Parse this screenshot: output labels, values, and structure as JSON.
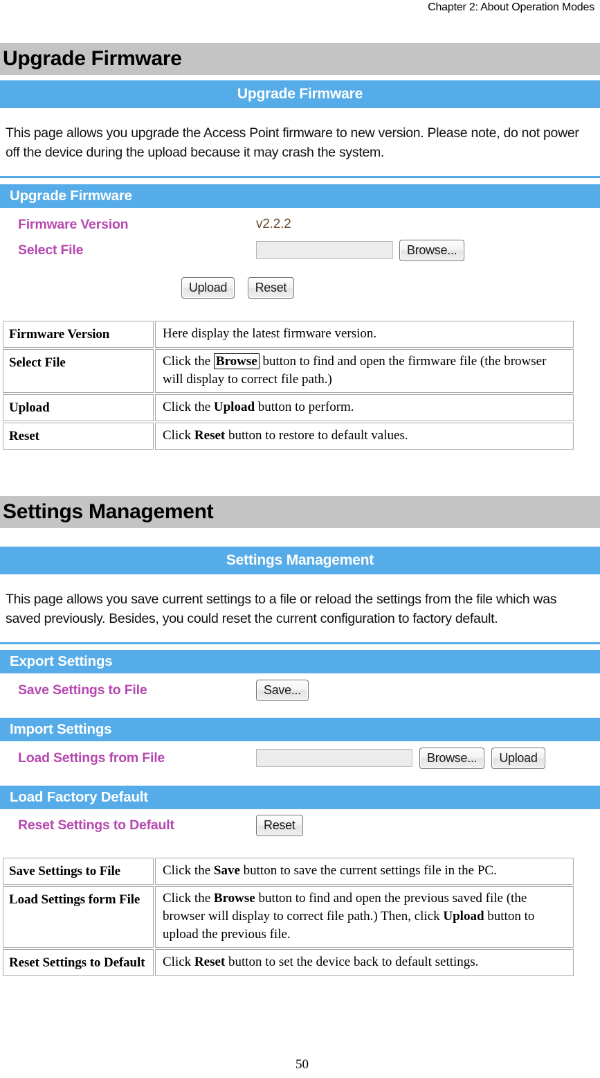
{
  "page": {
    "running_header": "Chapter 2: About Operation Modes",
    "page_number": "50",
    "accent_blue": "#55ace8",
    "heading_gray": "#c4c4c4",
    "label_magenta": "#b648b0"
  },
  "firmware": {
    "section_heading": "Upgrade Firmware",
    "ui": {
      "titlebar": "Upgrade Firmware",
      "description": "This page allows you upgrade the Access Point firmware to new version. Please note, do not power off the device during the upload because it may crash the system.",
      "panel_head": "Upgrade Firmware",
      "rows": [
        {
          "label": "Firmware Version",
          "value": "v2.2.2"
        },
        {
          "label": "Select File",
          "input_value": "",
          "browse_label": "Browse..."
        }
      ],
      "upload_label": "Upload",
      "reset_label": "Reset"
    },
    "table": {
      "rows": [
        {
          "key": "Firmware Version",
          "value_parts": [
            {
              "t": "Here display the latest firmware version.",
              "s": "n"
            }
          ]
        },
        {
          "key": "Select File",
          "value_parts": [
            {
              "t": "Click the ",
              "s": "n"
            },
            {
              "t": "Browse",
              "s": "boxed"
            },
            {
              "t": " button to find and open the firmware file (the browser will display to correct file path.)",
              "s": "n"
            }
          ]
        },
        {
          "key": "Upload",
          "value_parts": [
            {
              "t": "Click the ",
              "s": "n"
            },
            {
              "t": "Upload",
              "s": "b"
            },
            {
              "t": " button to perform.",
              "s": "n"
            }
          ]
        },
        {
          "key": "Reset",
          "value_parts": [
            {
              "t": "Click ",
              "s": "n"
            },
            {
              "t": "Reset",
              "s": "b"
            },
            {
              "t": " button to restore to default values.",
              "s": "n"
            }
          ]
        }
      ]
    }
  },
  "settings": {
    "section_heading": "Settings Management",
    "ui": {
      "titlebar": "Settings Management",
      "description": "This page allows you save current settings to a file or reload the settings from the file which was saved previously. Besides, you could reset the current configuration to factory default.",
      "export_head": "Export Settings",
      "export_label": "Save Settings to File",
      "save_label": "Save...",
      "import_head": "Import Settings",
      "import_label": "Load Settings from File",
      "import_input_value": "",
      "browse_label": "Browse...",
      "upload_label": "Upload",
      "factory_head": "Load Factory Default",
      "factory_label": "Reset Settings to Default",
      "reset_label": "Reset"
    },
    "table": {
      "rows": [
        {
          "key": "Save Settings to File",
          "value_parts": [
            {
              "t": "Click the ",
              "s": "n"
            },
            {
              "t": "Save",
              "s": "b"
            },
            {
              "t": " button to save the current settings file in the PC.",
              "s": "n"
            }
          ]
        },
        {
          "key": "Load Settings form File",
          "value_parts": [
            {
              "t": "Click the ",
              "s": "n"
            },
            {
              "t": "Browse",
              "s": "b"
            },
            {
              "t": " button to find and open the previous saved file (the browser will display to correct file path.) Then, click ",
              "s": "n"
            },
            {
              "t": "Upload",
              "s": "b"
            },
            {
              "t": " button to upload the previous file.",
              "s": "n"
            }
          ]
        },
        {
          "key": "Reset Settings to Default",
          "value_parts": [
            {
              "t": "Click ",
              "s": "n"
            },
            {
              "t": "Reset",
              "s": "b"
            },
            {
              "t": " button to set the device back to default settings.",
              "s": "n"
            }
          ]
        }
      ]
    }
  }
}
